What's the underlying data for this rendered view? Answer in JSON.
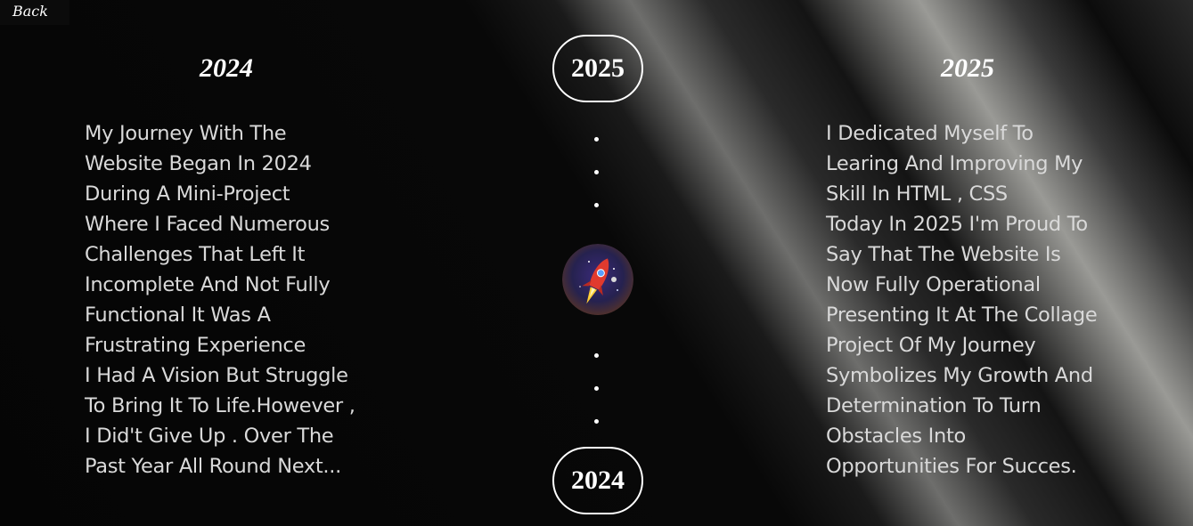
{
  "nav": {
    "back_label": "Back"
  },
  "timeline": {
    "top_pill": "2025",
    "bottom_pill": "2024"
  },
  "left": {
    "year": "2024",
    "text": "My Journey With The\nWebsite Began In 2024\nDuring A Mini-Project\nWhere I Faced Numerous\nChallenges That Left It\nIncomplete And Not Fully\nFunctional It Was A\nFrustrating Experience\nI Had A Vision But Struggle\nTo Bring It To Life.However ,\nI Did't Give Up . Over The\nPast Year All Round Next..."
  },
  "right": {
    "year": "2025",
    "text": "I Dedicated Myself To\nLearing And Improving My\nSkill In HTML , CSS\nToday In 2025 I'm Proud To\nSay That The Website Is\nNow Fully Operational\nPresenting It At The Collage\nProject Of My Journey\nSymbolizes My Growth And\nDetermination To Turn\nObstacles Into\nOpportunities For Succes."
  },
  "icons": {
    "center_avatar": "rocket-icon"
  },
  "colors": {
    "background": "#000000",
    "text": "#d9d9d9",
    "accent": "#ffffff"
  }
}
